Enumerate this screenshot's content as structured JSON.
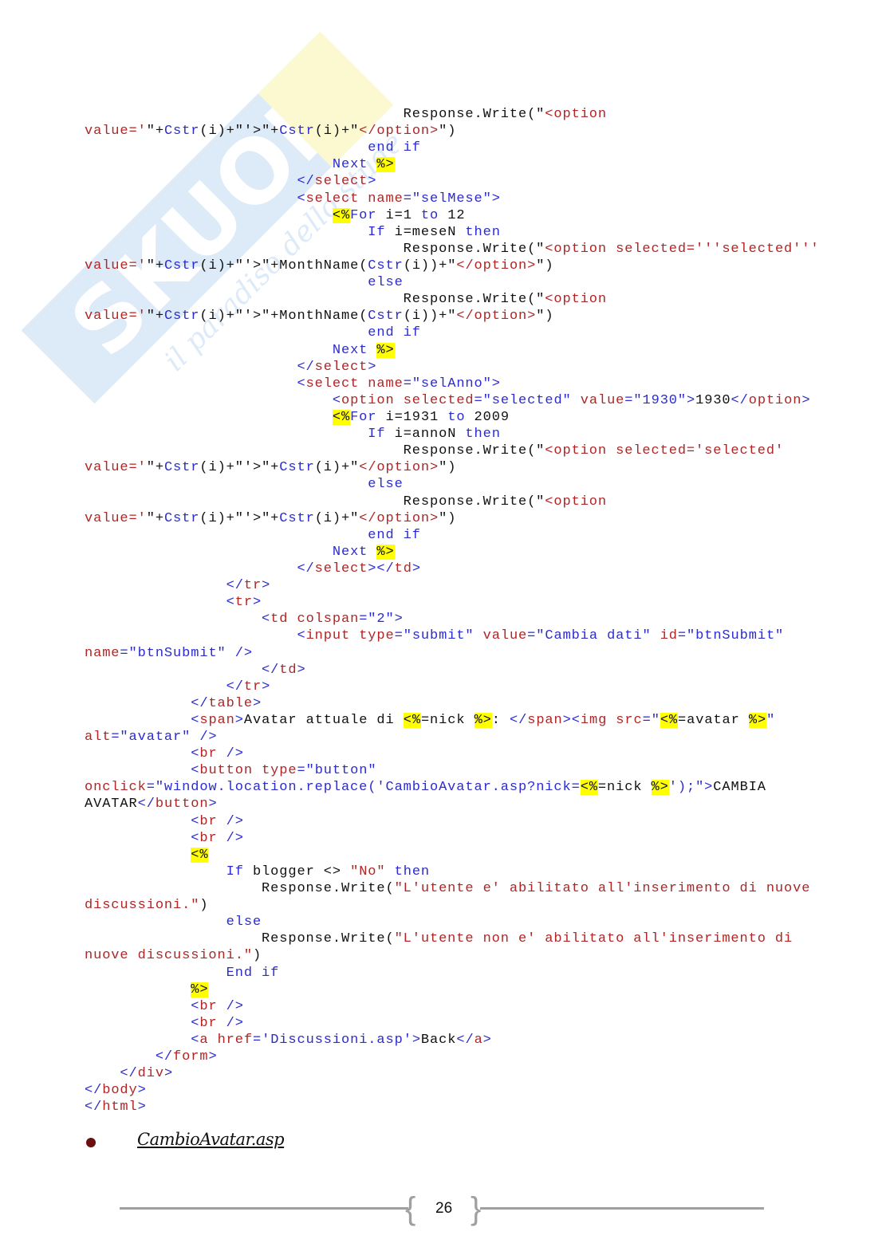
{
  "watermark": {
    "brand": "SKUOLA.net",
    "tagline": "il paradiso dello studente"
  },
  "code_lines": [
    [
      [
        "p",
        "                                    Response.Write(\""
      ],
      [
        "r",
        "<option"
      ]
    ],
    [
      [
        "r",
        "value='"
      ],
      [
        "p",
        "\"+"
      ],
      [
        "b",
        "Cstr"
      ],
      [
        "p",
        "(i)+\"'>\"+"
      ],
      [
        "b",
        "Cstr"
      ],
      [
        "p",
        "(i)+\""
      ],
      [
        "r",
        "</option>"
      ],
      [
        "p",
        "\")"
      ]
    ],
    [
      [
        "p",
        "                                "
      ],
      [
        "b",
        "end if"
      ]
    ],
    [
      [
        "p",
        "                            "
      ],
      [
        "b",
        "Next "
      ],
      [
        "h",
        "%>"
      ]
    ],
    [
      [
        "p",
        "                        "
      ],
      [
        "b",
        "</"
      ],
      [
        "r",
        "select"
      ],
      [
        "b",
        ">"
      ]
    ],
    [
      [
        "p",
        "                        "
      ],
      [
        "b",
        "<"
      ],
      [
        "r",
        "select"
      ],
      [
        "p",
        " "
      ],
      [
        "r",
        "name"
      ],
      [
        "b",
        "=\"selMese\">"
      ]
    ],
    [
      [
        "p",
        "                            "
      ],
      [
        "h",
        "<%"
      ],
      [
        "b",
        "For"
      ],
      [
        "p",
        " i=1 "
      ],
      [
        "b",
        "to"
      ],
      [
        "p",
        " 12"
      ]
    ],
    [
      [
        "p",
        "                                "
      ],
      [
        "b",
        "If"
      ],
      [
        "p",
        " i=meseN "
      ],
      [
        "b",
        "then"
      ]
    ],
    [
      [
        "p",
        "                                    Response.Write(\""
      ],
      [
        "r",
        "<option selected='''selected'''"
      ]
    ],
    [
      [
        "r",
        "value='"
      ],
      [
        "p",
        "\"+"
      ],
      [
        "b",
        "Cstr"
      ],
      [
        "p",
        "(i)+\"'>\"+MonthName("
      ],
      [
        "b",
        "Cstr"
      ],
      [
        "p",
        "(i))+\""
      ],
      [
        "r",
        "</option>"
      ],
      [
        "p",
        "\")"
      ]
    ],
    [
      [
        "p",
        "                                "
      ],
      [
        "b",
        "else"
      ]
    ],
    [
      [
        "p",
        "                                    Response.Write(\""
      ],
      [
        "r",
        "<option"
      ]
    ],
    [
      [
        "r",
        "value='"
      ],
      [
        "p",
        "\"+"
      ],
      [
        "b",
        "Cstr"
      ],
      [
        "p",
        "(i)+\"'>\"+MonthName("
      ],
      [
        "b",
        "Cstr"
      ],
      [
        "p",
        "(i))+\""
      ],
      [
        "r",
        "</option>"
      ],
      [
        "p",
        "\")"
      ]
    ],
    [
      [
        "p",
        "                                "
      ],
      [
        "b",
        "end if"
      ]
    ],
    [
      [
        "p",
        "                            "
      ],
      [
        "b",
        "Next "
      ],
      [
        "h",
        "%>"
      ]
    ],
    [
      [
        "p",
        "                        "
      ],
      [
        "b",
        "</"
      ],
      [
        "r",
        "select"
      ],
      [
        "b",
        ">"
      ]
    ],
    [
      [
        "p",
        "                        "
      ],
      [
        "b",
        "<"
      ],
      [
        "r",
        "select"
      ],
      [
        "p",
        " "
      ],
      [
        "r",
        "name"
      ],
      [
        "b",
        "=\"selAnno\">"
      ]
    ],
    [
      [
        "p",
        "                            "
      ],
      [
        "b",
        "<"
      ],
      [
        "r",
        "option"
      ],
      [
        "p",
        " "
      ],
      [
        "r",
        "selected"
      ],
      [
        "b",
        "=\"selected\""
      ],
      [
        "p",
        " "
      ],
      [
        "r",
        "value"
      ],
      [
        "b",
        "=\"1930\">"
      ],
      [
        "p",
        "1930"
      ],
      [
        "b",
        "</"
      ],
      [
        "r",
        "option"
      ],
      [
        "b",
        ">"
      ]
    ],
    [
      [
        "p",
        "                            "
      ],
      [
        "h",
        "<%"
      ],
      [
        "b",
        "For"
      ],
      [
        "p",
        " i=1931 "
      ],
      [
        "b",
        "to"
      ],
      [
        "p",
        " 2009"
      ]
    ],
    [
      [
        "p",
        "                                "
      ],
      [
        "b",
        "If"
      ],
      [
        "p",
        " i=annoN "
      ],
      [
        "b",
        "then"
      ]
    ],
    [
      [
        "p",
        "                                    Response.Write(\""
      ],
      [
        "r",
        "<option selected='selected'"
      ]
    ],
    [
      [
        "r",
        "value='"
      ],
      [
        "p",
        "\"+"
      ],
      [
        "b",
        "Cstr"
      ],
      [
        "p",
        "(i)+\"'>\"+"
      ],
      [
        "b",
        "Cstr"
      ],
      [
        "p",
        "(i)+\""
      ],
      [
        "r",
        "</option>"
      ],
      [
        "p",
        "\")"
      ]
    ],
    [
      [
        "p",
        "                                "
      ],
      [
        "b",
        "else"
      ]
    ],
    [
      [
        "p",
        "                                    Response.Write(\""
      ],
      [
        "r",
        "<option"
      ]
    ],
    [
      [
        "r",
        "value='"
      ],
      [
        "p",
        "\"+"
      ],
      [
        "b",
        "Cstr"
      ],
      [
        "p",
        "(i)+\"'>\"+"
      ],
      [
        "b",
        "Cstr"
      ],
      [
        "p",
        "(i)+\""
      ],
      [
        "r",
        "</option>"
      ],
      [
        "p",
        "\")"
      ]
    ],
    [
      [
        "p",
        "                                "
      ],
      [
        "b",
        "end if"
      ]
    ],
    [
      [
        "p",
        "                            "
      ],
      [
        "b",
        "Next "
      ],
      [
        "h",
        "%>"
      ]
    ],
    [
      [
        "p",
        "                        "
      ],
      [
        "b",
        "</"
      ],
      [
        "r",
        "select"
      ],
      [
        "b",
        "></"
      ],
      [
        "r",
        "td"
      ],
      [
        "b",
        ">"
      ]
    ],
    [
      [
        "p",
        "                "
      ],
      [
        "b",
        "</"
      ],
      [
        "r",
        "tr"
      ],
      [
        "b",
        ">"
      ]
    ],
    [
      [
        "p",
        "                "
      ],
      [
        "b",
        "<"
      ],
      [
        "r",
        "tr"
      ],
      [
        "b",
        ">"
      ]
    ],
    [
      [
        "p",
        "                    "
      ],
      [
        "b",
        "<"
      ],
      [
        "r",
        "td"
      ],
      [
        "p",
        " "
      ],
      [
        "r",
        "colspan"
      ],
      [
        "b",
        "=\"2\">"
      ]
    ],
    [
      [
        "p",
        "                        "
      ],
      [
        "b",
        "<"
      ],
      [
        "r",
        "input"
      ],
      [
        "p",
        " "
      ],
      [
        "r",
        "type"
      ],
      [
        "b",
        "=\"submit\""
      ],
      [
        "p",
        " "
      ],
      [
        "r",
        "value"
      ],
      [
        "b",
        "=\"Cambia dati\""
      ],
      [
        "p",
        " "
      ],
      [
        "r",
        "id"
      ],
      [
        "b",
        "=\"btnSubmit\""
      ]
    ],
    [
      [
        "r",
        "name"
      ],
      [
        "b",
        "=\"btnSubmit\" />"
      ]
    ],
    [
      [
        "p",
        "                    "
      ],
      [
        "b",
        "</"
      ],
      [
        "r",
        "td"
      ],
      [
        "b",
        ">"
      ]
    ],
    [
      [
        "p",
        "                "
      ],
      [
        "b",
        "</"
      ],
      [
        "r",
        "tr"
      ],
      [
        "b",
        ">"
      ]
    ],
    [
      [
        "p",
        "            "
      ],
      [
        "b",
        "</"
      ],
      [
        "r",
        "table"
      ],
      [
        "b",
        ">"
      ]
    ],
    [
      [
        "p",
        "            "
      ],
      [
        "b",
        "<"
      ],
      [
        "r",
        "span"
      ],
      [
        "b",
        ">"
      ],
      [
        "p",
        "Avatar attuale di "
      ],
      [
        "h",
        "<%"
      ],
      [
        "p",
        "=nick "
      ],
      [
        "h",
        "%>"
      ],
      [
        "p",
        ": "
      ],
      [
        "b",
        "</"
      ],
      [
        "r",
        "span"
      ],
      [
        "b",
        "><"
      ],
      [
        "r",
        "img"
      ],
      [
        "p",
        " "
      ],
      [
        "r",
        "src"
      ],
      [
        "b",
        "=\""
      ],
      [
        "h",
        "<%"
      ],
      [
        "p",
        "=avatar "
      ],
      [
        "h",
        "%>"
      ],
      [
        "b",
        "\""
      ]
    ],
    [
      [
        "r",
        "alt"
      ],
      [
        "b",
        "=\"avatar\" />"
      ]
    ],
    [
      [
        "p",
        "            "
      ],
      [
        "b",
        "<"
      ],
      [
        "r",
        "br"
      ],
      [
        "b",
        " />"
      ]
    ],
    [
      [
        "p",
        "            "
      ],
      [
        "b",
        "<"
      ],
      [
        "r",
        "button"
      ],
      [
        "p",
        " "
      ],
      [
        "r",
        "type"
      ],
      [
        "b",
        "=\"button\""
      ]
    ],
    [
      [
        "r",
        "onclick"
      ],
      [
        "b",
        "=\"window.location.replace('CambioAvatar.asp?nick="
      ],
      [
        "h",
        "<%"
      ],
      [
        "p",
        "=nick "
      ],
      [
        "h",
        "%>"
      ],
      [
        "b",
        "');\">"
      ],
      [
        "p",
        "CAMBIA"
      ]
    ],
    [
      [
        "p",
        "AVATAR"
      ],
      [
        "b",
        "</"
      ],
      [
        "r",
        "button"
      ],
      [
        "b",
        ">"
      ]
    ],
    [
      [
        "p",
        "            "
      ],
      [
        "b",
        "<"
      ],
      [
        "r",
        "br"
      ],
      [
        "b",
        " />"
      ]
    ],
    [
      [
        "p",
        "            "
      ],
      [
        "b",
        "<"
      ],
      [
        "r",
        "br"
      ],
      [
        "b",
        " />"
      ]
    ],
    [
      [
        "p",
        "            "
      ],
      [
        "h",
        "<%"
      ]
    ],
    [
      [
        "p",
        "                "
      ],
      [
        "b",
        "If"
      ],
      [
        "p",
        " blogger <> "
      ],
      [
        "r",
        "\"No\""
      ],
      [
        "p",
        " "
      ],
      [
        "b",
        "then"
      ]
    ],
    [
      [
        "p",
        "                    Response.Write("
      ],
      [
        "r",
        "\"L'utente e' abilitato all'inserimento di nuove"
      ]
    ],
    [
      [
        "r",
        "discussioni.\""
      ],
      [
        "p",
        ")"
      ]
    ],
    [
      [
        "p",
        "                "
      ],
      [
        "b",
        "else"
      ]
    ],
    [
      [
        "p",
        "                    Response.Write("
      ],
      [
        "r",
        "\"L'utente non e' abilitato all'inserimento di"
      ]
    ],
    [
      [
        "r",
        "nuove discussioni.\""
      ],
      [
        "p",
        ")"
      ]
    ],
    [
      [
        "p",
        "                "
      ],
      [
        "b",
        "End if"
      ]
    ],
    [
      [
        "p",
        "            "
      ],
      [
        "h",
        "%>"
      ]
    ],
    [
      [
        "p",
        "            "
      ],
      [
        "b",
        "<"
      ],
      [
        "r",
        "br"
      ],
      [
        "b",
        " />"
      ]
    ],
    [
      [
        "p",
        "            "
      ],
      [
        "b",
        "<"
      ],
      [
        "r",
        "br"
      ],
      [
        "b",
        " />"
      ]
    ],
    [
      [
        "p",
        "            "
      ],
      [
        "b",
        "<"
      ],
      [
        "r",
        "a"
      ],
      [
        "p",
        " "
      ],
      [
        "r",
        "href"
      ],
      [
        "b",
        "='Discussioni.asp'>"
      ],
      [
        "p",
        "Back"
      ],
      [
        "b",
        "</"
      ],
      [
        "r",
        "a"
      ],
      [
        "b",
        ">"
      ]
    ],
    [
      [
        "p",
        "        "
      ],
      [
        "b",
        "</"
      ],
      [
        "r",
        "form"
      ],
      [
        "b",
        ">"
      ]
    ],
    [
      [
        "p",
        "    "
      ],
      [
        "b",
        "</"
      ],
      [
        "r",
        "div"
      ],
      [
        "b",
        ">"
      ]
    ],
    [
      [
        "b",
        "</"
      ],
      [
        "r",
        "body"
      ],
      [
        "b",
        ">"
      ]
    ],
    [
      [
        "b",
        "</"
      ],
      [
        "r",
        "html"
      ],
      [
        "b",
        ">"
      ]
    ]
  ],
  "section": {
    "heading": "CambioAvatar.asp",
    "bullet_color": "#6b0f0f"
  },
  "footer": {
    "page_number": "26"
  },
  "colors": {
    "keyword": "#2b2bd0",
    "attribute": "#b02525",
    "highlight": "#ffff00"
  }
}
